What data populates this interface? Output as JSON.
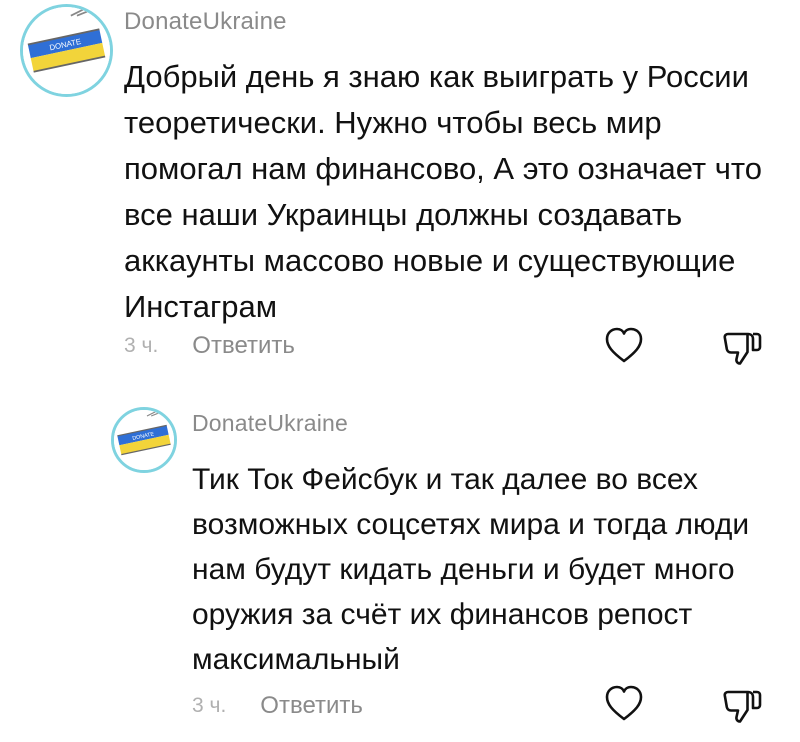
{
  "comments": [
    {
      "username": "DonateUkraine",
      "text": "Добрый день я знаю как выиграть у России теоретически. Нужно чтобы весь мир помогал нам финансово, А это означает что все наши Украинцы должны создавать аккаунты массово новые и существующие Инстаграм",
      "time": "3 ч.",
      "reply_label": "Ответить",
      "like_icon": "heart-icon",
      "dislike_icon": "thumbs-down-icon"
    },
    {
      "username": "DonateUkraine",
      "text": "Тик Ток Фейсбук и так далее во всех возможных соцсетях мира и тогда люди нам будут кидать деньги и будет много оружия за счёт их финансов репост максимальный",
      "time": "3 ч.",
      "reply_label": "Ответить",
      "like_icon": "heart-icon",
      "dislike_icon": "thumbs-down-icon"
    }
  ],
  "avatar": {
    "label": "DONATE",
    "colors": {
      "blue": "#2f6fd6",
      "yellow": "#f2d43a",
      "border": "#7fd3e0"
    }
  }
}
